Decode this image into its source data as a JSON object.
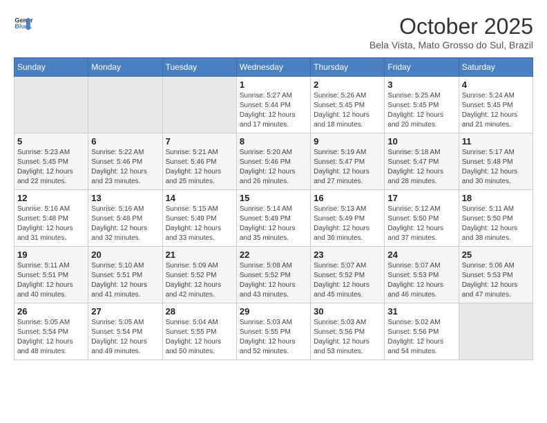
{
  "header": {
    "logo_line1": "General",
    "logo_line2": "Blue",
    "month": "October 2025",
    "location": "Bela Vista, Mato Grosso do Sul, Brazil"
  },
  "days_of_week": [
    "Sunday",
    "Monday",
    "Tuesday",
    "Wednesday",
    "Thursday",
    "Friday",
    "Saturday"
  ],
  "weeks": [
    [
      {
        "day": "",
        "info": ""
      },
      {
        "day": "",
        "info": ""
      },
      {
        "day": "",
        "info": ""
      },
      {
        "day": "1",
        "info": "Sunrise: 5:27 AM\nSunset: 5:44 PM\nDaylight: 12 hours\nand 17 minutes."
      },
      {
        "day": "2",
        "info": "Sunrise: 5:26 AM\nSunset: 5:45 PM\nDaylight: 12 hours\nand 18 minutes."
      },
      {
        "day": "3",
        "info": "Sunrise: 5:25 AM\nSunset: 5:45 PM\nDaylight: 12 hours\nand 20 minutes."
      },
      {
        "day": "4",
        "info": "Sunrise: 5:24 AM\nSunset: 5:45 PM\nDaylight: 12 hours\nand 21 minutes."
      }
    ],
    [
      {
        "day": "5",
        "info": "Sunrise: 5:23 AM\nSunset: 5:45 PM\nDaylight: 12 hours\nand 22 minutes."
      },
      {
        "day": "6",
        "info": "Sunrise: 5:22 AM\nSunset: 5:46 PM\nDaylight: 12 hours\nand 23 minutes."
      },
      {
        "day": "7",
        "info": "Sunrise: 5:21 AM\nSunset: 5:46 PM\nDaylight: 12 hours\nand 25 minutes."
      },
      {
        "day": "8",
        "info": "Sunrise: 5:20 AM\nSunset: 5:46 PM\nDaylight: 12 hours\nand 26 minutes."
      },
      {
        "day": "9",
        "info": "Sunrise: 5:19 AM\nSunset: 5:47 PM\nDaylight: 12 hours\nand 27 minutes."
      },
      {
        "day": "10",
        "info": "Sunrise: 5:18 AM\nSunset: 5:47 PM\nDaylight: 12 hours\nand 28 minutes."
      },
      {
        "day": "11",
        "info": "Sunrise: 5:17 AM\nSunset: 5:48 PM\nDaylight: 12 hours\nand 30 minutes."
      }
    ],
    [
      {
        "day": "12",
        "info": "Sunrise: 5:16 AM\nSunset: 5:48 PM\nDaylight: 12 hours\nand 31 minutes."
      },
      {
        "day": "13",
        "info": "Sunrise: 5:16 AM\nSunset: 5:48 PM\nDaylight: 12 hours\nand 32 minutes."
      },
      {
        "day": "14",
        "info": "Sunrise: 5:15 AM\nSunset: 5:49 PM\nDaylight: 12 hours\nand 33 minutes."
      },
      {
        "day": "15",
        "info": "Sunrise: 5:14 AM\nSunset: 5:49 PM\nDaylight: 12 hours\nand 35 minutes."
      },
      {
        "day": "16",
        "info": "Sunrise: 5:13 AM\nSunset: 5:49 PM\nDaylight: 12 hours\nand 36 minutes."
      },
      {
        "day": "17",
        "info": "Sunrise: 5:12 AM\nSunset: 5:50 PM\nDaylight: 12 hours\nand 37 minutes."
      },
      {
        "day": "18",
        "info": "Sunrise: 5:11 AM\nSunset: 5:50 PM\nDaylight: 12 hours\nand 38 minutes."
      }
    ],
    [
      {
        "day": "19",
        "info": "Sunrise: 5:11 AM\nSunset: 5:51 PM\nDaylight: 12 hours\nand 40 minutes."
      },
      {
        "day": "20",
        "info": "Sunrise: 5:10 AM\nSunset: 5:51 PM\nDaylight: 12 hours\nand 41 minutes."
      },
      {
        "day": "21",
        "info": "Sunrise: 5:09 AM\nSunset: 5:52 PM\nDaylight: 12 hours\nand 42 minutes."
      },
      {
        "day": "22",
        "info": "Sunrise: 5:08 AM\nSunset: 5:52 PM\nDaylight: 12 hours\nand 43 minutes."
      },
      {
        "day": "23",
        "info": "Sunrise: 5:07 AM\nSunset: 5:52 PM\nDaylight: 12 hours\nand 45 minutes."
      },
      {
        "day": "24",
        "info": "Sunrise: 5:07 AM\nSunset: 5:53 PM\nDaylight: 12 hours\nand 46 minutes."
      },
      {
        "day": "25",
        "info": "Sunrise: 5:06 AM\nSunset: 5:53 PM\nDaylight: 12 hours\nand 47 minutes."
      }
    ],
    [
      {
        "day": "26",
        "info": "Sunrise: 5:05 AM\nSunset: 5:54 PM\nDaylight: 12 hours\nand 48 minutes."
      },
      {
        "day": "27",
        "info": "Sunrise: 5:05 AM\nSunset: 5:54 PM\nDaylight: 12 hours\nand 49 minutes."
      },
      {
        "day": "28",
        "info": "Sunrise: 5:04 AM\nSunset: 5:55 PM\nDaylight: 12 hours\nand 50 minutes."
      },
      {
        "day": "29",
        "info": "Sunrise: 5:03 AM\nSunset: 5:55 PM\nDaylight: 12 hours\nand 52 minutes."
      },
      {
        "day": "30",
        "info": "Sunrise: 5:03 AM\nSunset: 5:56 PM\nDaylight: 12 hours\nand 53 minutes."
      },
      {
        "day": "31",
        "info": "Sunrise: 5:02 AM\nSunset: 5:56 PM\nDaylight: 12 hours\nand 54 minutes."
      },
      {
        "day": "",
        "info": ""
      }
    ]
  ]
}
